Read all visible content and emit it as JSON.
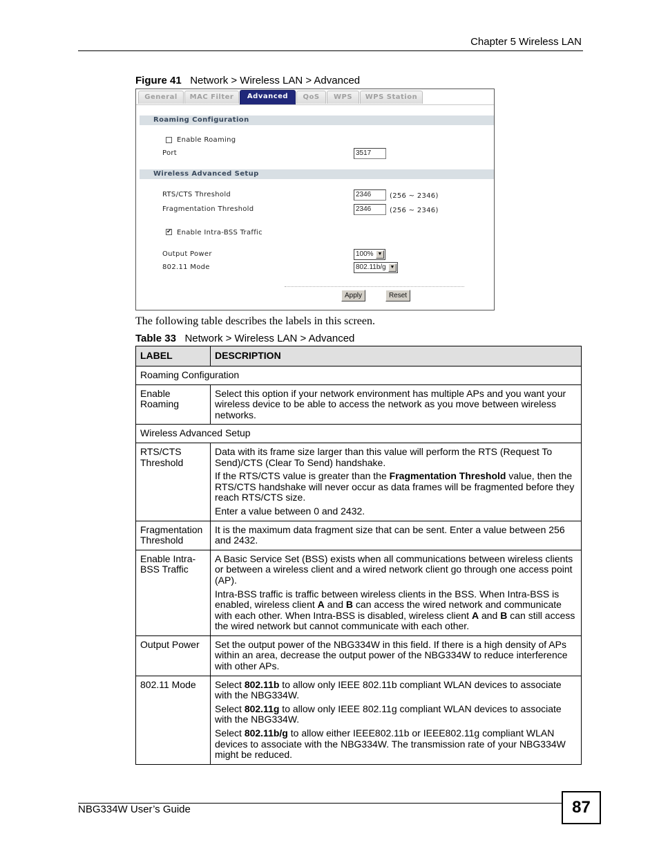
{
  "header": {
    "chapter": "Chapter 5 Wireless LAN"
  },
  "figure": {
    "label": "Figure 41",
    "title": "Network > Wireless LAN > Advanced",
    "tabs": [
      {
        "label": "General",
        "active": false
      },
      {
        "label": "MAC Filter",
        "active": false
      },
      {
        "label": "Advanced",
        "active": true
      },
      {
        "label": "QoS",
        "active": false
      },
      {
        "label": "WPS",
        "active": false
      },
      {
        "label": "WPS Station",
        "active": false
      }
    ],
    "roaming": {
      "section_title": "Roaming Configuration",
      "enable_roaming_label": "Enable Roaming",
      "enable_roaming_checked": false,
      "port_label": "Port",
      "port_value": "3517"
    },
    "advanced": {
      "section_title": "Wireless Advanced Setup",
      "rts_label": "RTS/CTS  Threshold",
      "rts_value": "2346",
      "rts_range": "(256 ~ 2346)",
      "frag_label": "Fragmentation  Threshold",
      "frag_value": "2346",
      "frag_range": "(256 ~ 2346)",
      "intra_bss_label": "Enable Intra-BSS Traffic",
      "intra_bss_checked": true,
      "output_power_label": "Output Power",
      "output_power_value": "100%",
      "mode_label": "802.11 Mode",
      "mode_value": "802.11b/g"
    },
    "buttons": {
      "apply": "Apply",
      "reset": "Reset"
    },
    "icons": {
      "checked": "✔",
      "dropdown": "▼"
    }
  },
  "intro": "The following table describes the labels in this screen.",
  "table": {
    "label": "Table 33",
    "title": "Network > Wireless LAN > Advanced",
    "headers": {
      "label": "LABEL",
      "description": "DESCRIPTION"
    },
    "sections": {
      "roaming": "Roaming Configuration",
      "advanced": "Wireless Advanced Setup"
    },
    "rows": {
      "enable_roaming": {
        "label": "Enable Roaming",
        "p1": "Select this option if your network environment has multiple APs and you want your wireless device to be able to access the network as you move between wireless networks."
      },
      "rts": {
        "label": "RTS/CTS Threshold",
        "p1": "Data with its frame size larger than this value will perform the RTS (Request To Send)/CTS (Clear To Send) handshake.",
        "p2_a": "If the RTS/CTS value is greater than the ",
        "p2_b": "Fragmentation Threshold",
        "p2_c": " value, then the RTS/CTS handshake will never occur as data frames will be fragmented before they reach RTS/CTS size.",
        "p3": "Enter a value between 0 and 2432."
      },
      "frag": {
        "label": "Fragmentation Threshold",
        "p1": "It is the maximum data fragment size that can be sent. Enter a value between 256 and 2432."
      },
      "intra_bss": {
        "label": "Enable Intra-BSS Traffic",
        "p1": "A Basic Service Set (BSS) exists when all communications between wireless clients or between a wireless client and a wired network client go through one access point (AP).",
        "p2_a": "Intra-BSS traffic is traffic between wireless clients in the BSS. When Intra-BSS is enabled, wireless client ",
        "p2_b": "A",
        "p2_c": " and ",
        "p2_d": "B",
        "p2_e": " can access the wired network and communicate with each other. When Intra-BSS is disabled, wireless client ",
        "p2_f": "A",
        "p2_g": " and ",
        "p2_h": "B",
        "p2_i": " can still access the wired network but cannot communicate with each other."
      },
      "output_power": {
        "label": "Output Power",
        "p1": "Set the output power of the NBG334W in this field. If there is a high density of APs within an area, decrease the output power of the NBG334W to reduce interference with other APs."
      },
      "mode": {
        "label": "802.11 Mode",
        "p1_a": "Select ",
        "p1_b": "802.11b",
        "p1_c": " to allow only IEEE 802.11b compliant WLAN devices to associate with the NBG334W.",
        "p2_a": "Select ",
        "p2_b": "802.11g",
        "p2_c": " to allow only IEEE 802.11g compliant WLAN devices to associate with the NBG334W.",
        "p3_a": "Select ",
        "p3_b": "802.11b/g",
        "p3_c": " to allow either IEEE802.11b or IEEE802.11g compliant WLAN devices to associate with the NBG334W. The transmission rate of your NBG334W might be reduced."
      }
    }
  },
  "footer": {
    "guide": "NBG334W User’s Guide",
    "page_number": "87"
  }
}
